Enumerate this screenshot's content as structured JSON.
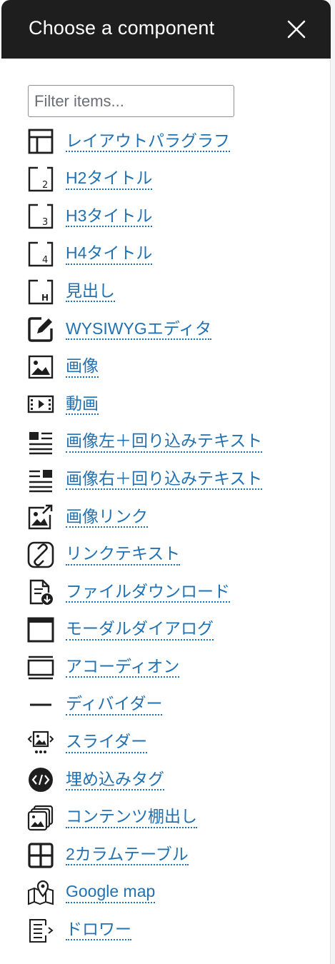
{
  "header": {
    "title": "Choose a component",
    "close_label": "Close"
  },
  "filter": {
    "placeholder": "Filter items...",
    "value": ""
  },
  "components": [
    {
      "label": "レイアウトパラグラフ",
      "icon": "layout-icon"
    },
    {
      "label": "H2タイトル",
      "icon": "heading-2-icon"
    },
    {
      "label": "H3タイトル",
      "icon": "heading-3-icon"
    },
    {
      "label": "H4タイトル",
      "icon": "heading-4-icon"
    },
    {
      "label": "見出し",
      "icon": "heading-icon"
    },
    {
      "label": "WYSIWYGエディタ",
      "icon": "edit-icon"
    },
    {
      "label": "画像",
      "icon": "image-icon"
    },
    {
      "label": "動画",
      "icon": "video-icon"
    },
    {
      "label": "画像左＋回り込みテキスト",
      "icon": "image-left-text-icon"
    },
    {
      "label": "画像右＋回り込みテキスト",
      "icon": "image-right-text-icon"
    },
    {
      "label": "画像リンク",
      "icon": "image-link-icon"
    },
    {
      "label": "リンクテキスト",
      "icon": "link-icon"
    },
    {
      "label": "ファイルダウンロード",
      "icon": "file-download-icon"
    },
    {
      "label": "モーダルダイアログ",
      "icon": "modal-icon"
    },
    {
      "label": "アコーディオン",
      "icon": "accordion-icon"
    },
    {
      "label": "ディバイダー",
      "icon": "divider-icon"
    },
    {
      "label": "スライダー",
      "icon": "slider-icon"
    },
    {
      "label": "埋め込みタグ",
      "icon": "embed-code-icon"
    },
    {
      "label": "コンテンツ棚出し",
      "icon": "content-shelf-icon"
    },
    {
      "label": "2カラムテーブル",
      "icon": "table-icon"
    },
    {
      "label": "Google map",
      "icon": "map-icon"
    },
    {
      "label": "ドロワー",
      "icon": "drawer-icon"
    }
  ],
  "colors": {
    "header_bg": "#1e1e1e",
    "link": "#2271b1",
    "icon": "#1e1e1e"
  }
}
